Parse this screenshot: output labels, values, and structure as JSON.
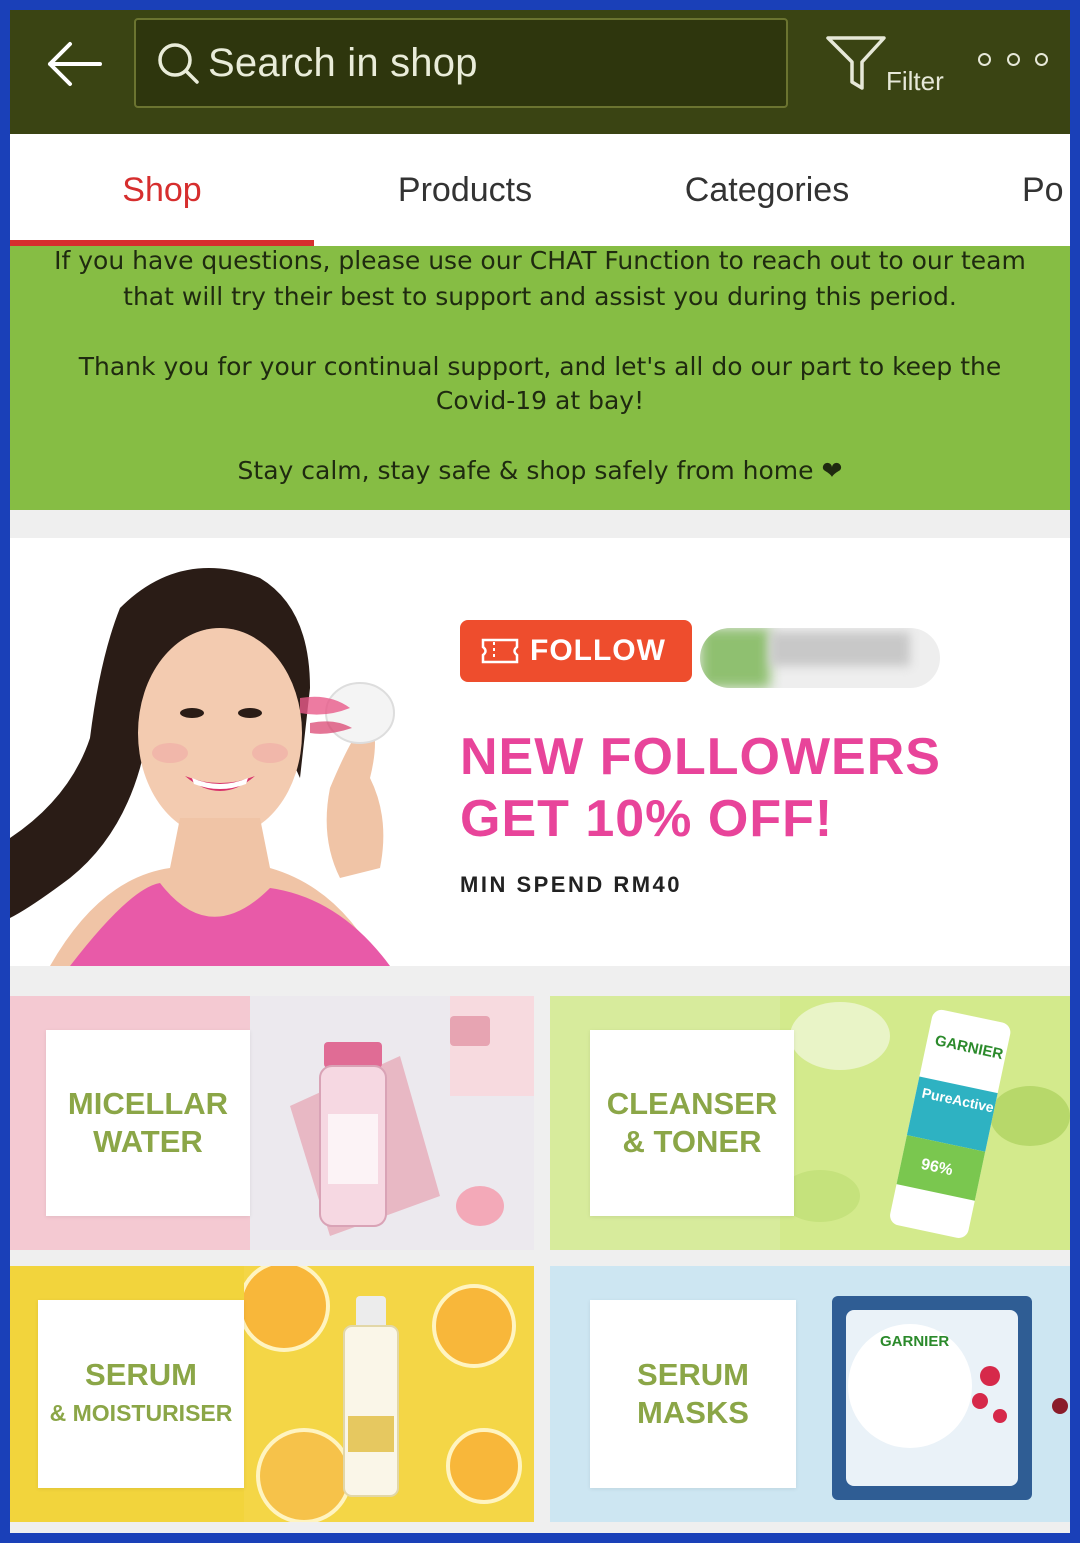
{
  "header": {
    "search_placeholder": "Search in shop",
    "filter_label": "Filter",
    "icons": [
      "back-arrow-icon",
      "search-icon",
      "filter-icon",
      "more-icon"
    ]
  },
  "tabs": [
    {
      "label": "Shop",
      "active": true
    },
    {
      "label": "Products",
      "active": false
    },
    {
      "label": "Categories",
      "active": false
    },
    {
      "label": "Po",
      "active": false
    }
  ],
  "notice": {
    "line1": "If you have questions, please use our CHAT Function to reach out to our team",
    "line2": "that will try their best to support and assist you during this period.",
    "line3": "Thank you for your continual support, and let's all do our part to keep the",
    "line4": "Covid-19 at bay!",
    "line5": "Stay calm, stay safe & shop safely from home ❤"
  },
  "banner": {
    "follow_label": "FOLLOW",
    "headline_1": "NEW FOLLOWERS",
    "headline_2": "GET 10% OFF!",
    "min_spend": "MIN SPEND RM40"
  },
  "categories": [
    {
      "line1": "MICELLAR",
      "line2": "WATER"
    },
    {
      "line1": "CLEANSER",
      "line2": "& TONER",
      "brand": "GARNIER",
      "product_text": "PureActive",
      "percent": "96%"
    },
    {
      "line1": "SERUM",
      "line2": "& MOISTURISER"
    },
    {
      "line1": "SERUM",
      "line2": "MASKS",
      "brand": "GARNIER"
    }
  ],
  "colors": {
    "header_bg": "#3a4413",
    "accent_red": "#d62e2e",
    "notice_bg": "#86bd44",
    "follow_orange": "#ee4d2d",
    "headline_pink": "#e8449a",
    "frame_blue": "#1a40b8"
  }
}
